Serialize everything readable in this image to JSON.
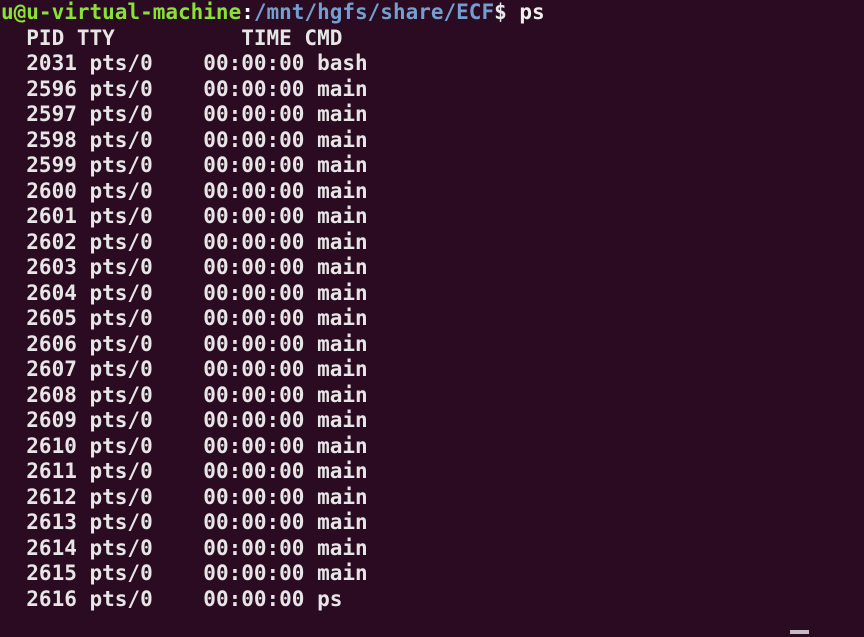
{
  "terminal": {
    "background_color": "#2b0b21",
    "foreground_color": "#e6e6e6",
    "colors": {
      "user_host": "#8ae234",
      "path": "#729fcf",
      "punctuation": "#ffffff",
      "command": "#eeeeec",
      "cursor": "#c8b8c4"
    },
    "prompt": {
      "user_host": "u@u-virtual-machine",
      "separator": ":",
      "path": "/mnt/hgfs/share/ECF",
      "symbol": "$",
      "command": "ps",
      "full_line": "u@u-virtual-machine:/mnt/hgfs/share/ECF$ ps"
    },
    "ps_output": {
      "header": "  PID TTY          TIME CMD",
      "columns": [
        "PID",
        "TTY",
        "TIME",
        "CMD"
      ],
      "rows": [
        {
          "pid": "2031",
          "tty": "pts/0",
          "time": "00:00:00",
          "cmd": "bash"
        },
        {
          "pid": "2596",
          "tty": "pts/0",
          "time": "00:00:00",
          "cmd": "main"
        },
        {
          "pid": "2597",
          "tty": "pts/0",
          "time": "00:00:00",
          "cmd": "main"
        },
        {
          "pid": "2598",
          "tty": "pts/0",
          "time": "00:00:00",
          "cmd": "main"
        },
        {
          "pid": "2599",
          "tty": "pts/0",
          "time": "00:00:00",
          "cmd": "main"
        },
        {
          "pid": "2600",
          "tty": "pts/0",
          "time": "00:00:00",
          "cmd": "main"
        },
        {
          "pid": "2601",
          "tty": "pts/0",
          "time": "00:00:00",
          "cmd": "main"
        },
        {
          "pid": "2602",
          "tty": "pts/0",
          "time": "00:00:00",
          "cmd": "main"
        },
        {
          "pid": "2603",
          "tty": "pts/0",
          "time": "00:00:00",
          "cmd": "main"
        },
        {
          "pid": "2604",
          "tty": "pts/0",
          "time": "00:00:00",
          "cmd": "main"
        },
        {
          "pid": "2605",
          "tty": "pts/0",
          "time": "00:00:00",
          "cmd": "main"
        },
        {
          "pid": "2606",
          "tty": "pts/0",
          "time": "00:00:00",
          "cmd": "main"
        },
        {
          "pid": "2607",
          "tty": "pts/0",
          "time": "00:00:00",
          "cmd": "main"
        },
        {
          "pid": "2608",
          "tty": "pts/0",
          "time": "00:00:00",
          "cmd": "main"
        },
        {
          "pid": "2609",
          "tty": "pts/0",
          "time": "00:00:00",
          "cmd": "main"
        },
        {
          "pid": "2610",
          "tty": "pts/0",
          "time": "00:00:00",
          "cmd": "main"
        },
        {
          "pid": "2611",
          "tty": "pts/0",
          "time": "00:00:00",
          "cmd": "main"
        },
        {
          "pid": "2612",
          "tty": "pts/0",
          "time": "00:00:00",
          "cmd": "main"
        },
        {
          "pid": "2613",
          "tty": "pts/0",
          "time": "00:00:00",
          "cmd": "main"
        },
        {
          "pid": "2614",
          "tty": "pts/0",
          "time": "00:00:00",
          "cmd": "main"
        },
        {
          "pid": "2615",
          "tty": "pts/0",
          "time": "00:00:00",
          "cmd": "main"
        },
        {
          "pid": "2616",
          "tty": "pts/0",
          "time": "00:00:00",
          "cmd": "ps"
        }
      ]
    }
  }
}
